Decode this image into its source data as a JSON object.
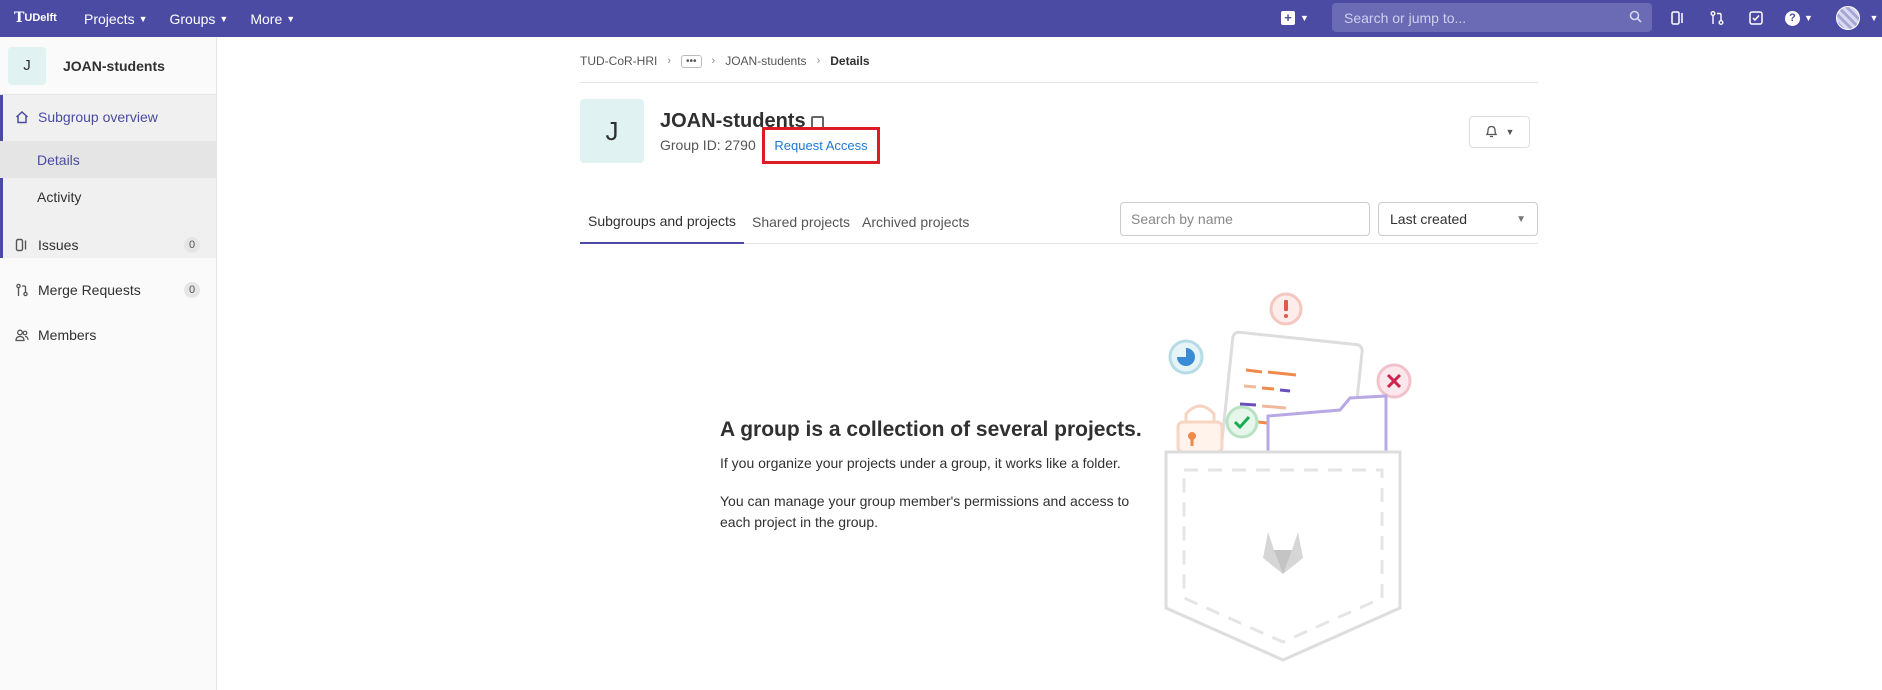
{
  "topbar": {
    "logo_mark": "T",
    "logo_text": "UDelft",
    "nav": [
      {
        "label": "Projects"
      },
      {
        "label": "Groups"
      },
      {
        "label": "More"
      }
    ],
    "search_placeholder": "Search or jump to...",
    "accent": "#4b4ba3"
  },
  "sidebar": {
    "avatar_letter": "J",
    "context_name": "JOAN-students",
    "overview_label": "Subgroup overview",
    "sub_items": [
      {
        "label": "Details"
      },
      {
        "label": "Activity"
      }
    ],
    "issues_label": "Issues",
    "issues_count": "0",
    "mr_label": "Merge Requests",
    "mr_count": "0",
    "members_label": "Members"
  },
  "breadcrumb": {
    "root": "TUD-CoR-HRI",
    "ellipsis": "•••",
    "group": "JOAN-students",
    "current": "Details"
  },
  "group": {
    "avatar_letter": "J",
    "title": "JOAN-students",
    "id_text": "Group ID: 2790",
    "request_access": "Request Access"
  },
  "tabs": [
    {
      "label": "Subgroups and projects"
    },
    {
      "label": "Shared projects"
    },
    {
      "label": "Archived projects"
    }
  ],
  "filter": {
    "placeholder": "Search by name",
    "sort_value": "Last created"
  },
  "empty_state": {
    "title": "A group is a collection of several projects.",
    "text1": "If you organize your projects under a group, it works like a folder.",
    "text2": "You can manage your group member's permissions and access to each project in the group."
  },
  "colors": {
    "highlight_box": "#dd1c25",
    "link": "#1f78d1"
  }
}
